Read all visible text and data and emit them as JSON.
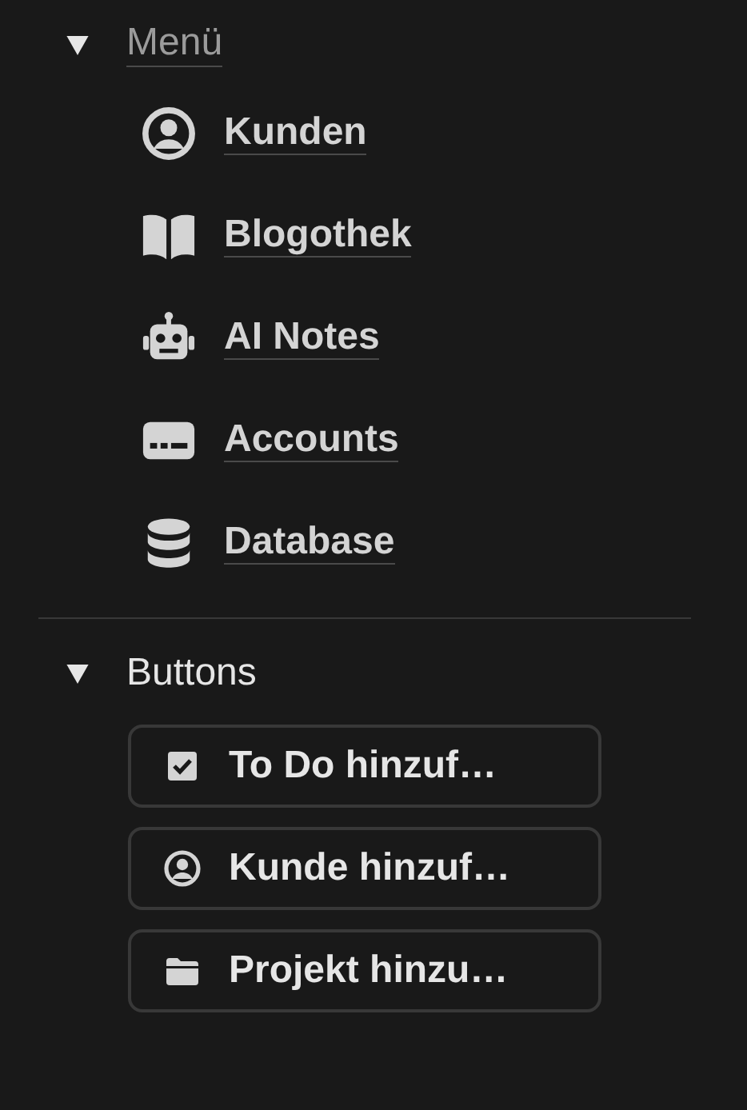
{
  "sections": [
    {
      "title": "Menü",
      "kind": "link",
      "expanded": true,
      "items": [
        {
          "kind": "link",
          "label": "Kunden"
        },
        {
          "kind": "link",
          "label": "Blogothek"
        },
        {
          "kind": "link",
          "label": "AI Notes"
        },
        {
          "kind": "link",
          "label": "Accounts"
        },
        {
          "kind": "link",
          "label": "Database"
        }
      ]
    },
    {
      "title": "Buttons",
      "kind": "plain",
      "expanded": true,
      "items": [
        {
          "kind": "button",
          "label": "To Do hinzuf…"
        },
        {
          "kind": "button",
          "label": "Kunde hinzuf…"
        },
        {
          "kind": "button",
          "label": "Projekt hinzu…"
        }
      ]
    }
  ]
}
